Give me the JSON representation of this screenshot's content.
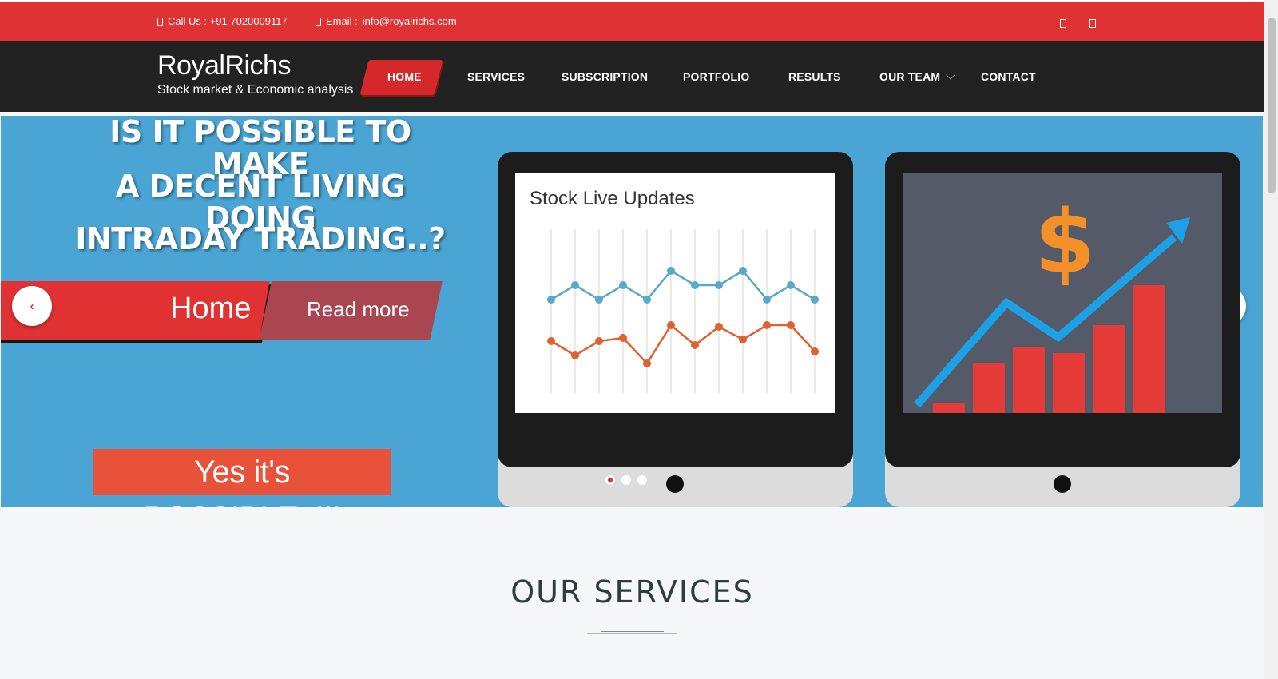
{
  "topbar": {
    "call_label": "Call Us : +91 7020009117",
    "email_label": "Email :",
    "email_value": "info@royalrichs.com"
  },
  "brand": {
    "name": "RoyalRichs",
    "tagline": "Stock market & Economic analysis"
  },
  "nav": {
    "items": [
      {
        "label": "HOME",
        "active": true
      },
      {
        "label": "SERVICES"
      },
      {
        "label": "SUBSCRIPTION"
      },
      {
        "label": "PORTFOLIO"
      },
      {
        "label": "RESULTS"
      },
      {
        "label": "OUR TEAM",
        "has_dropdown": true
      },
      {
        "label": "CONTACT"
      }
    ]
  },
  "hero": {
    "headline": [
      "IS IT POSSIBLE TO MAKE",
      "A DECENT LIVING DOING",
      "INTRADAY TRADING..?"
    ],
    "home_label": "Home",
    "read_more": "Read more",
    "possible": "Yes it's POSSIBLE..!!!",
    "chart_title": "Stock Live Updates",
    "dollar": "$",
    "slides": 3,
    "active_slide": 1
  },
  "services": {
    "title": "OUR SERVICES"
  },
  "colors": {
    "brand_red": "#e03233",
    "nav_bg": "#222222",
    "hero_bg": "#4aa5d4"
  }
}
